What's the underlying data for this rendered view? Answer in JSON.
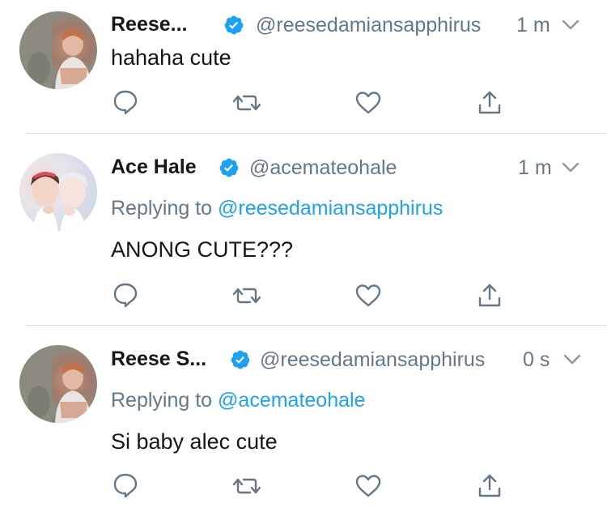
{
  "tweets": [
    {
      "name": "Reese...",
      "handle": "@reesedamiansapphirus",
      "time": "1 m",
      "replying_prefix": "",
      "replying_to": "",
      "text": "hahaha cute"
    },
    {
      "name": "Ace Hale",
      "handle": "@acemateohale",
      "time": "1 m",
      "replying_prefix": "Replying to ",
      "replying_to": "@reesedamiansapphirus",
      "text": "ANONG CUTE???"
    },
    {
      "name": "Reese S...",
      "handle": "@reesedamiansapphirus",
      "time": "0 s",
      "replying_prefix": "Replying to ",
      "replying_to": "@acemateohale",
      "text": "Si baby alec cute"
    }
  ],
  "actions": [
    "reply-icon",
    "retweet-icon",
    "like-icon",
    "share-icon"
  ],
  "colors": {
    "accent": "#1da1f2",
    "secondary_text": "#657786",
    "icon": "#657786",
    "divider": "#d8dde2"
  }
}
